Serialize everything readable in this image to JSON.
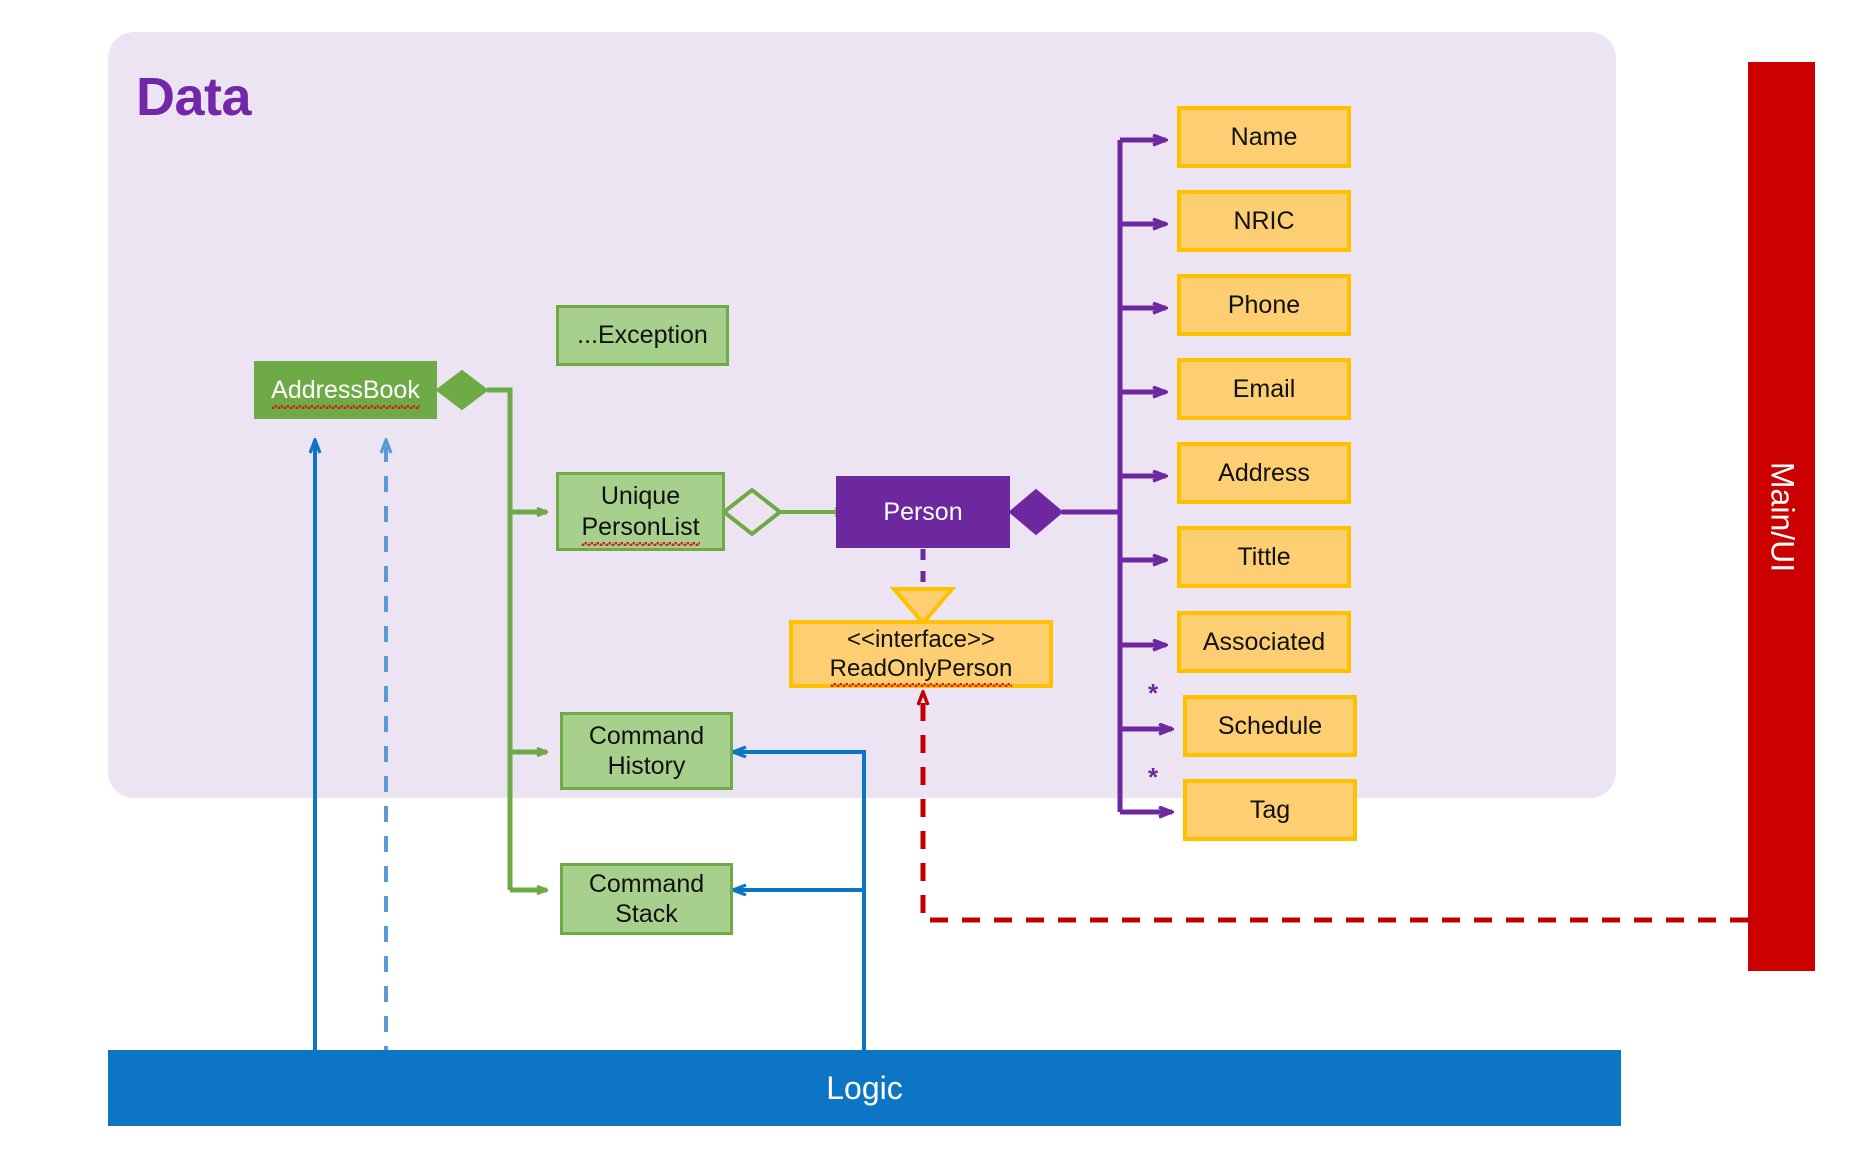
{
  "diagram": {
    "title": "Data",
    "type": "uml-class-diagram"
  },
  "package": {
    "label": "Data",
    "accent_color": "#7127A8",
    "fill_color": "#ECE4F2"
  },
  "bars": {
    "logic": {
      "label": "Logic",
      "color": "#0C76C4"
    },
    "main_ui": {
      "label": "Main/UI",
      "color": "#CC0000"
    }
  },
  "classes": {
    "address_book": {
      "label": "AddressBook",
      "fill": "#6EAB46",
      "text": "#FFFFFF"
    },
    "exception": {
      "label": "...Exception",
      "fill": "#A8D08D",
      "text": "#111111"
    },
    "unique_person_list": {
      "line1": "Unique",
      "line2": "PersonList",
      "fill": "#A8D08D",
      "text": "#111111"
    },
    "person": {
      "label": "Person",
      "fill": "#6D28A0",
      "text": "#FFFFFF"
    },
    "read_only_person": {
      "stereotype": "<<interface>>",
      "label": "ReadOnlyPerson",
      "fill": "#FDCE72",
      "border": "#FFC000"
    },
    "command_history": {
      "line1": "Command",
      "line2": "History",
      "fill": "#A8D08D"
    },
    "command_stack": {
      "line1": "Command",
      "line2": "Stack",
      "fill": "#A8D08D"
    }
  },
  "attributes": [
    {
      "label": "Name",
      "multiplicity": ""
    },
    {
      "label": "NRIC",
      "multiplicity": ""
    },
    {
      "label": "Phone",
      "multiplicity": ""
    },
    {
      "label": "Email",
      "multiplicity": ""
    },
    {
      "label": "Address",
      "multiplicity": ""
    },
    {
      "label": "Tittle",
      "multiplicity": ""
    },
    {
      "label": "Associated",
      "multiplicity": ""
    },
    {
      "label": "Schedule",
      "multiplicity": "*"
    },
    {
      "label": "Tag",
      "multiplicity": "*"
    }
  ],
  "colors": {
    "green_line": "#6EAB46",
    "purple_line": "#6D28A0",
    "blue_line": "#0C76C4",
    "blue_dashed": "#5B9BD5",
    "red_dashed": "#C00000",
    "orange_border": "#FFC000"
  }
}
